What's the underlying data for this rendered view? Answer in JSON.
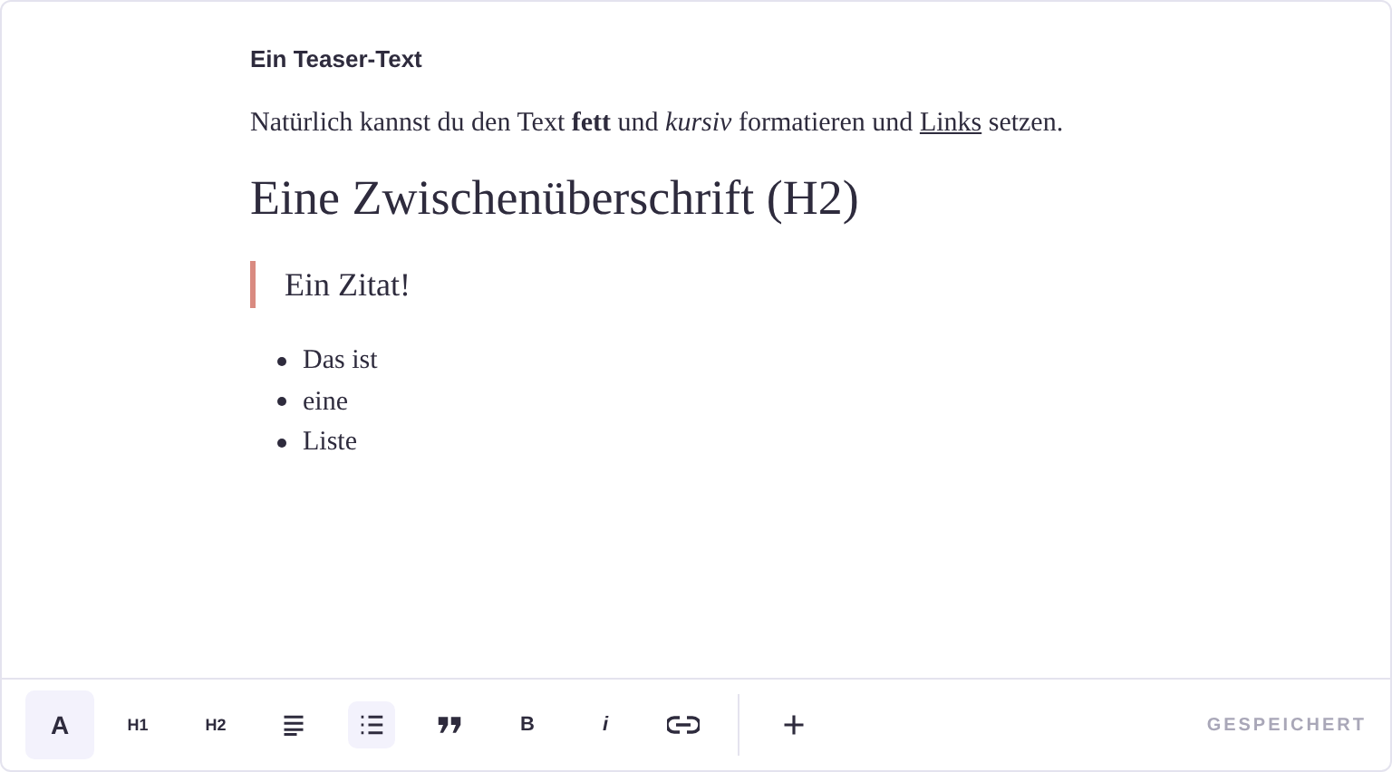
{
  "document": {
    "teaser": "Ein Teaser-Text",
    "paragraph": {
      "before": "Natürlich kannst du den Text **fett** und *kursiv* formatieren und ",
      "link": "Links",
      "after": " setzen."
    },
    "heading": "Eine Zwischenüberschrift (H2)",
    "quote": "Ein Zitat!",
    "list": [
      "Das ist",
      "eine",
      "Liste"
    ]
  },
  "toolbar": {
    "tools": [
      {
        "kind": "text",
        "label": "A",
        "selected": true
      },
      {
        "kind": "text",
        "label": "H1",
        "selected": false
      },
      {
        "kind": "text",
        "label": "H2",
        "selected": false
      },
      {
        "kind": "paragraph",
        "selected": false
      },
      {
        "kind": "list",
        "selected": true
      },
      {
        "kind": "quote",
        "selected": false
      },
      {
        "kind": "text",
        "label": "B",
        "selected": false
      },
      {
        "kind": "italic",
        "label": "i",
        "selected": false
      },
      {
        "kind": "link",
        "selected": false
      }
    ],
    "actions": [
      {
        "kind": "add"
      }
    ],
    "status": "GESPEICHERT"
  }
}
